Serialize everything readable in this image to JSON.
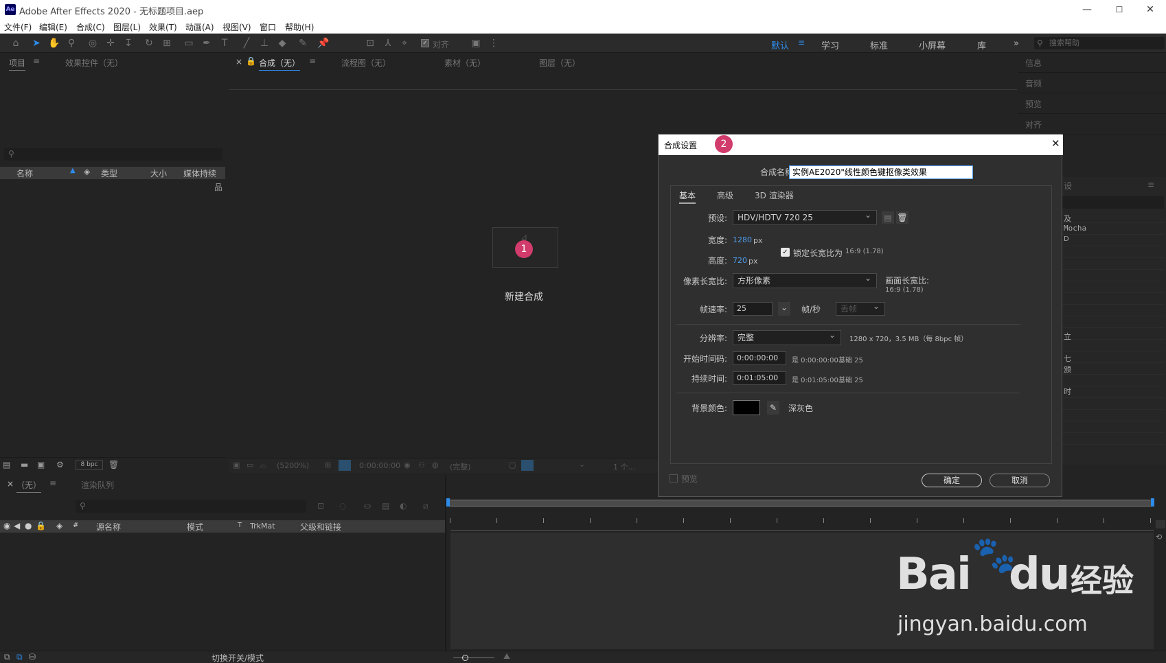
{
  "window": {
    "title": "Adobe After Effects 2020 - 无标题项目.aep",
    "logo": "Ae",
    "minimize": "—",
    "maximize": "☐",
    "close": "✕"
  },
  "menu": [
    "文件(F)",
    "编辑(E)",
    "合成(C)",
    "图层(L)",
    "效果(T)",
    "动画(A)",
    "视图(V)",
    "窗口",
    "帮助(H)"
  ],
  "toolbar": {
    "align_label": "对齐"
  },
  "workspaces": {
    "items": [
      "默认",
      "学习",
      "标准",
      "小屏幕",
      "库"
    ],
    "active": "默认",
    "more": "»",
    "search_placeholder": "搜索帮助"
  },
  "project_panel": {
    "tabs": [
      "项目",
      "效果控件（无）"
    ],
    "columns": [
      "名称",
      "类型",
      "大小",
      "媒体持续"
    ],
    "bpc": "8 bpc"
  },
  "comp_panel": {
    "tabs": [
      "合成（无）",
      "流程图（无）",
      "素材（无）",
      "图层（无）"
    ],
    "new_comp_label": "新建合成",
    "footer": {
      "zoom": "(5200%)",
      "timecode": "0:00:00:00",
      "quality": "(完整)",
      "views": "1 个..."
    }
  },
  "right_panel": {
    "items": [
      "信息",
      "音频",
      "预览",
      "对齐"
    ],
    "partial": [
      "设",
      "及",
      "Mocha",
      "D",
      "立",
      "七",
      "颁",
      "时"
    ]
  },
  "timeline": {
    "tabs": [
      "（无）",
      "渲染队列"
    ],
    "columns": [
      "源名称",
      "模式",
      "T",
      "TrkMat",
      "父级和链接"
    ],
    "footer": "切换开关/模式"
  },
  "dialog": {
    "title": "合成设置",
    "name_label": "合成名称:",
    "name_value": "实例AE2020\"线性颜色键抠像类效果",
    "tabs": [
      "基本",
      "高级",
      "3D 渲染器"
    ],
    "active_tab": "基本",
    "preset_label": "预设:",
    "preset_value": "HDV/HDTV 720 25",
    "width_label": "宽度:",
    "width_value": "1280",
    "height_label": "高度:",
    "height_value": "720",
    "px": "px",
    "lock_label": "锁定长宽比为",
    "lock_ratio": "16:9 (1.78)",
    "lock_checked": true,
    "pixel_aspect_label": "像素长宽比:",
    "pixel_aspect_value": "方形像素",
    "frame_aspect_label": "画面长宽比:",
    "frame_aspect_value": "16:9 (1.78)",
    "fps_label": "帧速率:",
    "fps_value": "25",
    "fps_unit": "帧/秒",
    "drop_frame": "丢帧",
    "resolution_label": "分辨率:",
    "resolution_value": "完整",
    "resolution_info": "1280 x 720，3.5 MB（每 8bpc 帧）",
    "start_label": "开始时间码:",
    "start_value": "0:00:00:00",
    "start_is": "是 0:00:00:00",
    "base_label": "基础 25",
    "duration_label": "持续时间:",
    "duration_value": "0:01:05:00",
    "duration_is": "是 0:01:05:00",
    "bg_label": "背景颜色:",
    "bg_color": "#000000",
    "bg_name": "深灰色",
    "preview_label": "预览",
    "ok": "确定",
    "cancel": "取消"
  },
  "annotations": {
    "badge1": "1",
    "badge2": "2"
  },
  "watermark": {
    "brand": "Bai",
    "paw": "du",
    "suffix": "经验",
    "url": "jingyan.baidu.com"
  },
  "colors": {
    "accent": "#2d8ceb",
    "badge": "#d13c6c",
    "panel": "#232323"
  }
}
